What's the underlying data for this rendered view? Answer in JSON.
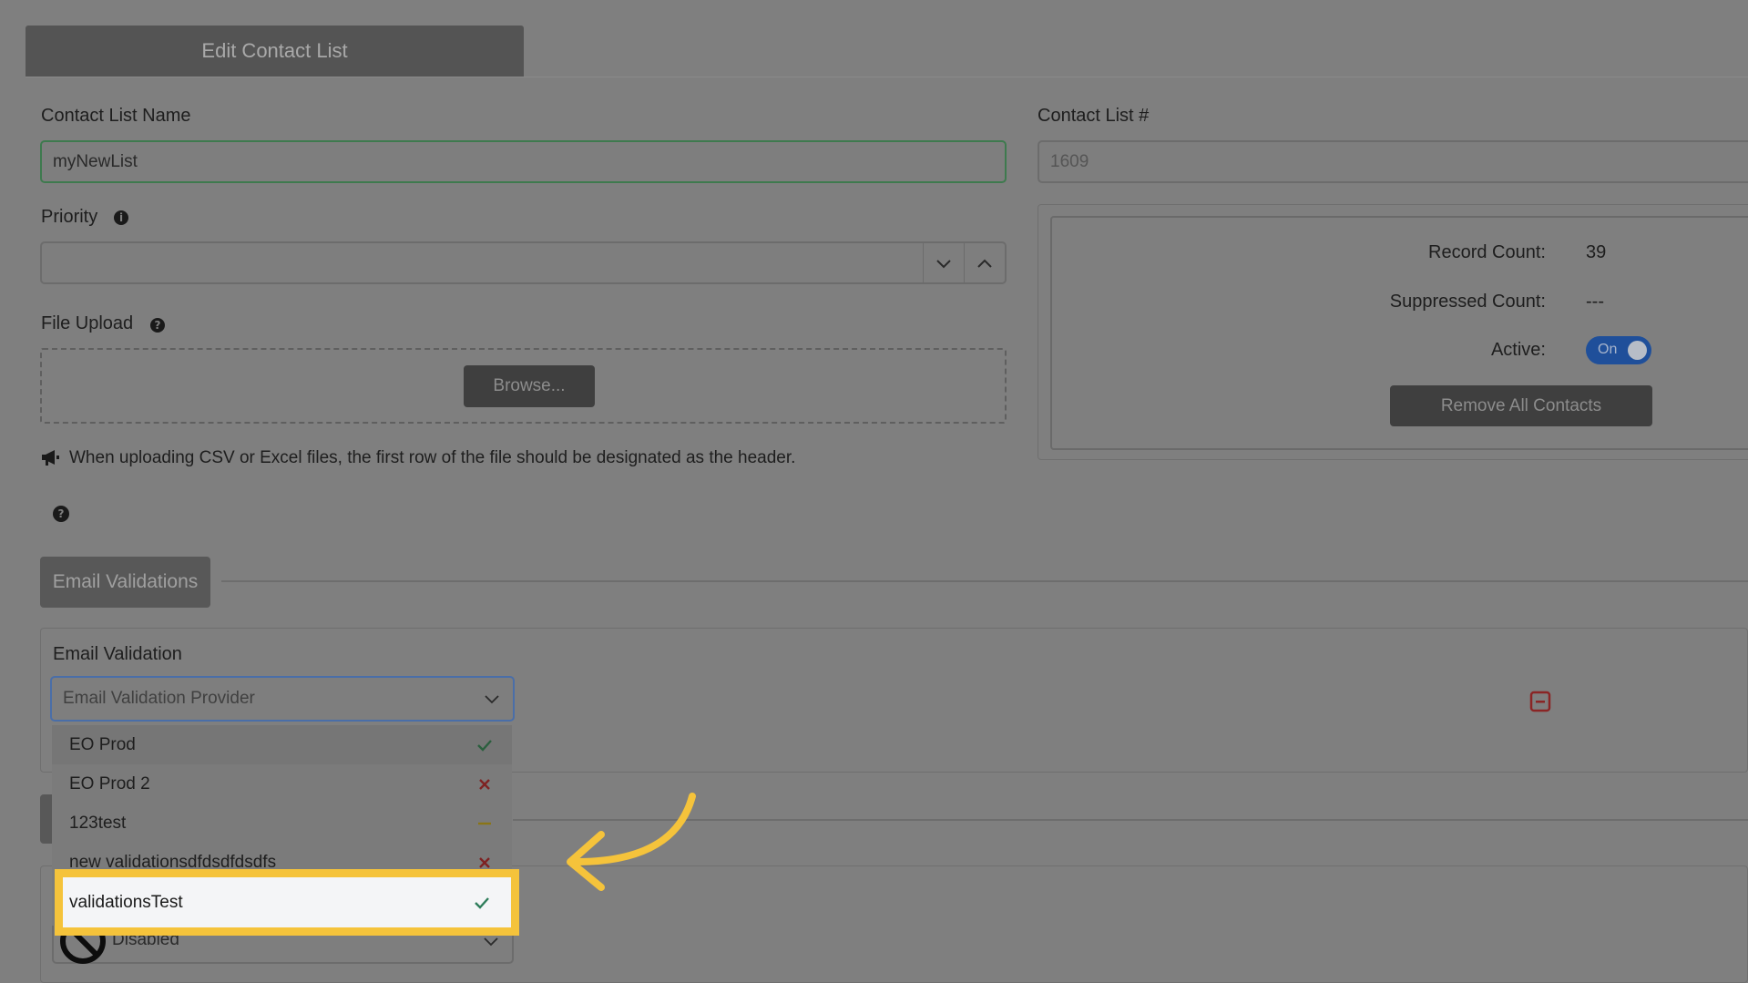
{
  "panel": {
    "title": "Edit Contact List"
  },
  "form": {
    "list_name_label": "Contact List Name",
    "list_name_value": "myNewList",
    "list_number_label": "Contact List #",
    "list_number_value": "1609",
    "priority_label": "Priority",
    "priority_value": "",
    "file_upload_label": "File Upload",
    "browse_label": "Browse...",
    "upload_note": "When uploading CSV or Excel files, the first row of the file should be designated as the header."
  },
  "stats": {
    "record_count_label": "Record Count:",
    "record_count_value": "39",
    "suppressed_count_label": "Suppressed Count:",
    "suppressed_count_value": "---",
    "active_label": "Active:",
    "active_toggle": "On",
    "remove_button": "Remove All Contacts"
  },
  "email_validations": {
    "section_title": "Email Validations",
    "field_label": "Email Validation",
    "placeholder": "Email Validation Provider",
    "options": [
      {
        "label": "EO Prod",
        "status": "valid"
      },
      {
        "label": "EO Prod 2",
        "status": "invalid"
      },
      {
        "label": "123test",
        "status": "pending"
      },
      {
        "label": "new validationsdfdsdfdsdfs",
        "status": "invalid"
      },
      {
        "label": "validationsTest",
        "status": "valid"
      }
    ],
    "disabled_select": "Disabled"
  },
  "colors": {
    "valid": "#2e7d5b",
    "invalid": "#b02a2a",
    "pending": "#b59a1a",
    "highlight": "#f5c33b",
    "toggle": "#1f4f9a"
  }
}
